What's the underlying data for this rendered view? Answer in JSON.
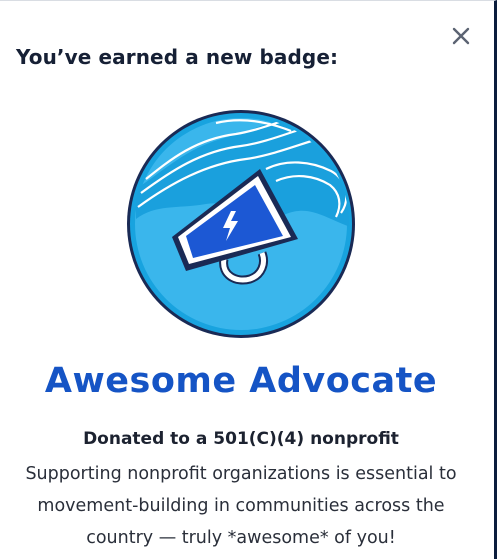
{
  "dialog": {
    "headline": "You’ve earned a new badge:",
    "close_icon": "close-icon",
    "badge": {
      "icon": "megaphone-icon",
      "name": "Awesome Advocate",
      "subtitle": "Donated to a 501(C)(4) nonprofit",
      "description": "Supporting nonprofit organizations is essential to movement-building in communities across the country — truly *awesome* of you!"
    }
  },
  "colors": {
    "badge_blue_light": "#3ab6ec",
    "badge_blue_mid": "#1aa0dd",
    "badge_navy": "#1a2a55",
    "megaphone_blue": "#1c58d4",
    "title_blue": "#1554c5"
  }
}
